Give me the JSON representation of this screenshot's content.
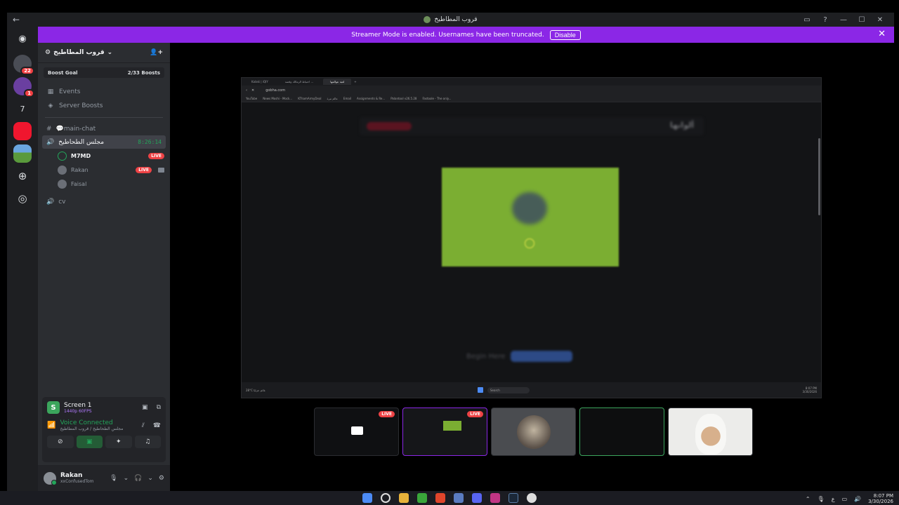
{
  "window": {
    "title": "قروب المطاطيخ",
    "back_icon": "arrow-left-icon"
  },
  "banner": {
    "message": "Streamer Mode is enabled. Usernames have been truncated.",
    "disable_label": "Disable",
    "color": "#8b27e6"
  },
  "rail": {
    "servers": [
      {
        "name": "server-1",
        "badge": "22"
      },
      {
        "name": "server-2",
        "badge": "1"
      },
      {
        "name": "server-3",
        "label": "7"
      },
      {
        "name": "server-4"
      },
      {
        "name": "server-5-active"
      }
    ]
  },
  "sidebar": {
    "server_name": "قروب المطاطيخ",
    "boost_goal": {
      "label": "Boost Goal",
      "value": "2/33 Boosts"
    },
    "items": [
      {
        "label": "Events",
        "icon": "calendar-icon"
      },
      {
        "label": "Server Boosts",
        "icon": "boost-icon"
      }
    ],
    "channels": {
      "text": {
        "label": "💬main-chat"
      },
      "voice_active": {
        "label": "مجلس الطحاطيخ",
        "timer": "8:26:14"
      },
      "voice_users": [
        {
          "name": "M7MD",
          "live": "LIVE"
        },
        {
          "name": "Rakan",
          "live": "LIVE"
        },
        {
          "name": "Faisal"
        }
      ],
      "voice_other": {
        "label": "cv"
      }
    },
    "screen_panel": {
      "title": "Screen 1",
      "quality": "1440p 60FPS"
    },
    "voice_connected": {
      "status": "Voice Connected",
      "location": "مجلس الطحاطيخ / قروب المطاطيخ"
    },
    "user": {
      "name": "Rakan",
      "status": "xxConfusedTom"
    }
  },
  "stream": {
    "browser": {
      "tabs": [
        "Kalaki | iQIY",
        "احتياط الزمالك وقصة ...",
        "لعبة عوالمها"
      ],
      "url": "gobha.com",
      "bookmarks": [
        "YouTube",
        "News Moshi - Mock...",
        "KThamArmyDeal",
        "عالم نبرة",
        "Email",
        "Assignments & Re...",
        "Palantool v26.5.28",
        "Fastoole - The only..."
      ]
    },
    "page": {
      "title": "ألوانها",
      "button_label": "Begin Here"
    },
    "taskbar": {
      "weather_temp": "28°C",
      "weather_desc": "غائم جزئيًا",
      "search": "Search",
      "time": "8:07 PM",
      "date": "3/30/2026"
    }
  },
  "thumbnails": [
    {
      "name": "thumb-screen-share",
      "live": "LIVE"
    },
    {
      "name": "thumb-browser-stream",
      "live": "LIVE"
    },
    {
      "name": "thumb-user-faisal"
    },
    {
      "name": "thumb-user-m7md"
    },
    {
      "name": "thumb-user-rakan"
    }
  ],
  "os_taskbar": {
    "time": "8:07 PM",
    "date": "3/30/2026",
    "lang": "ع"
  }
}
